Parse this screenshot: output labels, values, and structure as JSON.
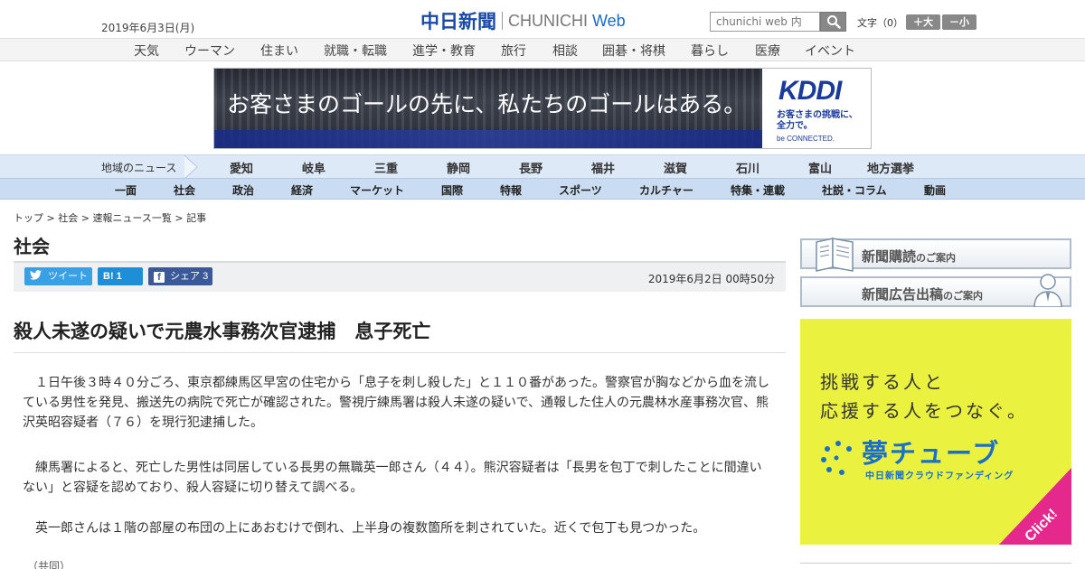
{
  "header": {
    "date": "2019年6月3日(月)",
    "logo_kanji": "中日新聞",
    "logo_en": "CHUNICHI",
    "logo_web": "Web",
    "search_placeholder": "chunichi web 内",
    "font_label": "文字（0）",
    "font_large": "＋大",
    "font_small": "－小"
  },
  "category_nav": [
    "天気",
    "ウーマン",
    "住まい",
    "就職・転職",
    "進学・教育",
    "旅行",
    "相談",
    "囲碁・将棋",
    "暮らし",
    "医療",
    "イベント"
  ],
  "ad": {
    "copy": "お客さまのゴールの先に、私たちのゴールはある。",
    "brand": "KDDI",
    "tagline_1": "お客さまの挑戦に、",
    "tagline_2": "全力で。",
    "sub": "be CONNECTED."
  },
  "regional_nav": {
    "label": "地域のニュース",
    "items": [
      "愛知",
      "岐阜",
      "三重",
      "静岡",
      "長野",
      "福井",
      "滋賀",
      "石川",
      "富山",
      "地方選挙"
    ]
  },
  "section_nav": [
    "一面",
    "社会",
    "政治",
    "経済",
    "マーケット",
    "国際",
    "特報",
    "スポーツ",
    "カルチャー",
    "特集・連載",
    "社説・コラム",
    "動画"
  ],
  "breadcrumb": [
    "トップ",
    "社会",
    "速報ニュース一覧",
    "記事"
  ],
  "breadcrumb_sep": " > ",
  "section_title": "社会",
  "share": {
    "tweet": "ツイート",
    "hatena": "B! 1",
    "facebook": "シェア 3"
  },
  "published": "2019年6月2日 00時50分",
  "article": {
    "headline": "殺人未遂の疑いで元農水事務次官逮捕　息子死亡",
    "paragraphs": [
      "　１日午後３時４０分ごろ、東京都練馬区早宮の住宅から「息子を刺し殺した」と１１０番があった。警察官が胸などから血を流している男性を発見、搬送先の病院で死亡が確認された。警視庁練馬署は殺人未遂の疑いで、通報した住人の元農林水産事務次官、熊沢英昭容疑者（７６）を現行犯逮捕した。",
      "　練馬署によると、死亡した男性は同居している長男の無職英一郎さん（４４）。熊沢容疑者は「長男を包丁で刺したことに間違いない」と容疑を認めており、殺人容疑に切り替えて調べる。",
      "　英一郎さんは１階の部屋の布団の上にあおむけで倒れ、上半身の複数箇所を刺されていた。近くで包丁も見つかった。"
    ],
    "credit": "（共同）"
  },
  "sidebar": {
    "subscribe": "新聞購読",
    "subscribe_small": "のご案内",
    "advertise": "新聞広告出稿",
    "advertise_small": "のご案内",
    "yume_line1": "挑戦する人と",
    "yume_line2": "応援する人をつなぐ。",
    "yume_logo": "夢チューブ",
    "yume_sub": "中日新聞クラウドファンディング",
    "yume_click": "Click!"
  },
  "colors": {
    "logo_blue": "#1a4aa8",
    "regional_nav_bg": "#dde9f6",
    "section_nav_bg": "#c9dcf1",
    "yume_bg": "#eaf23f",
    "click_pink": "#e5288c"
  }
}
